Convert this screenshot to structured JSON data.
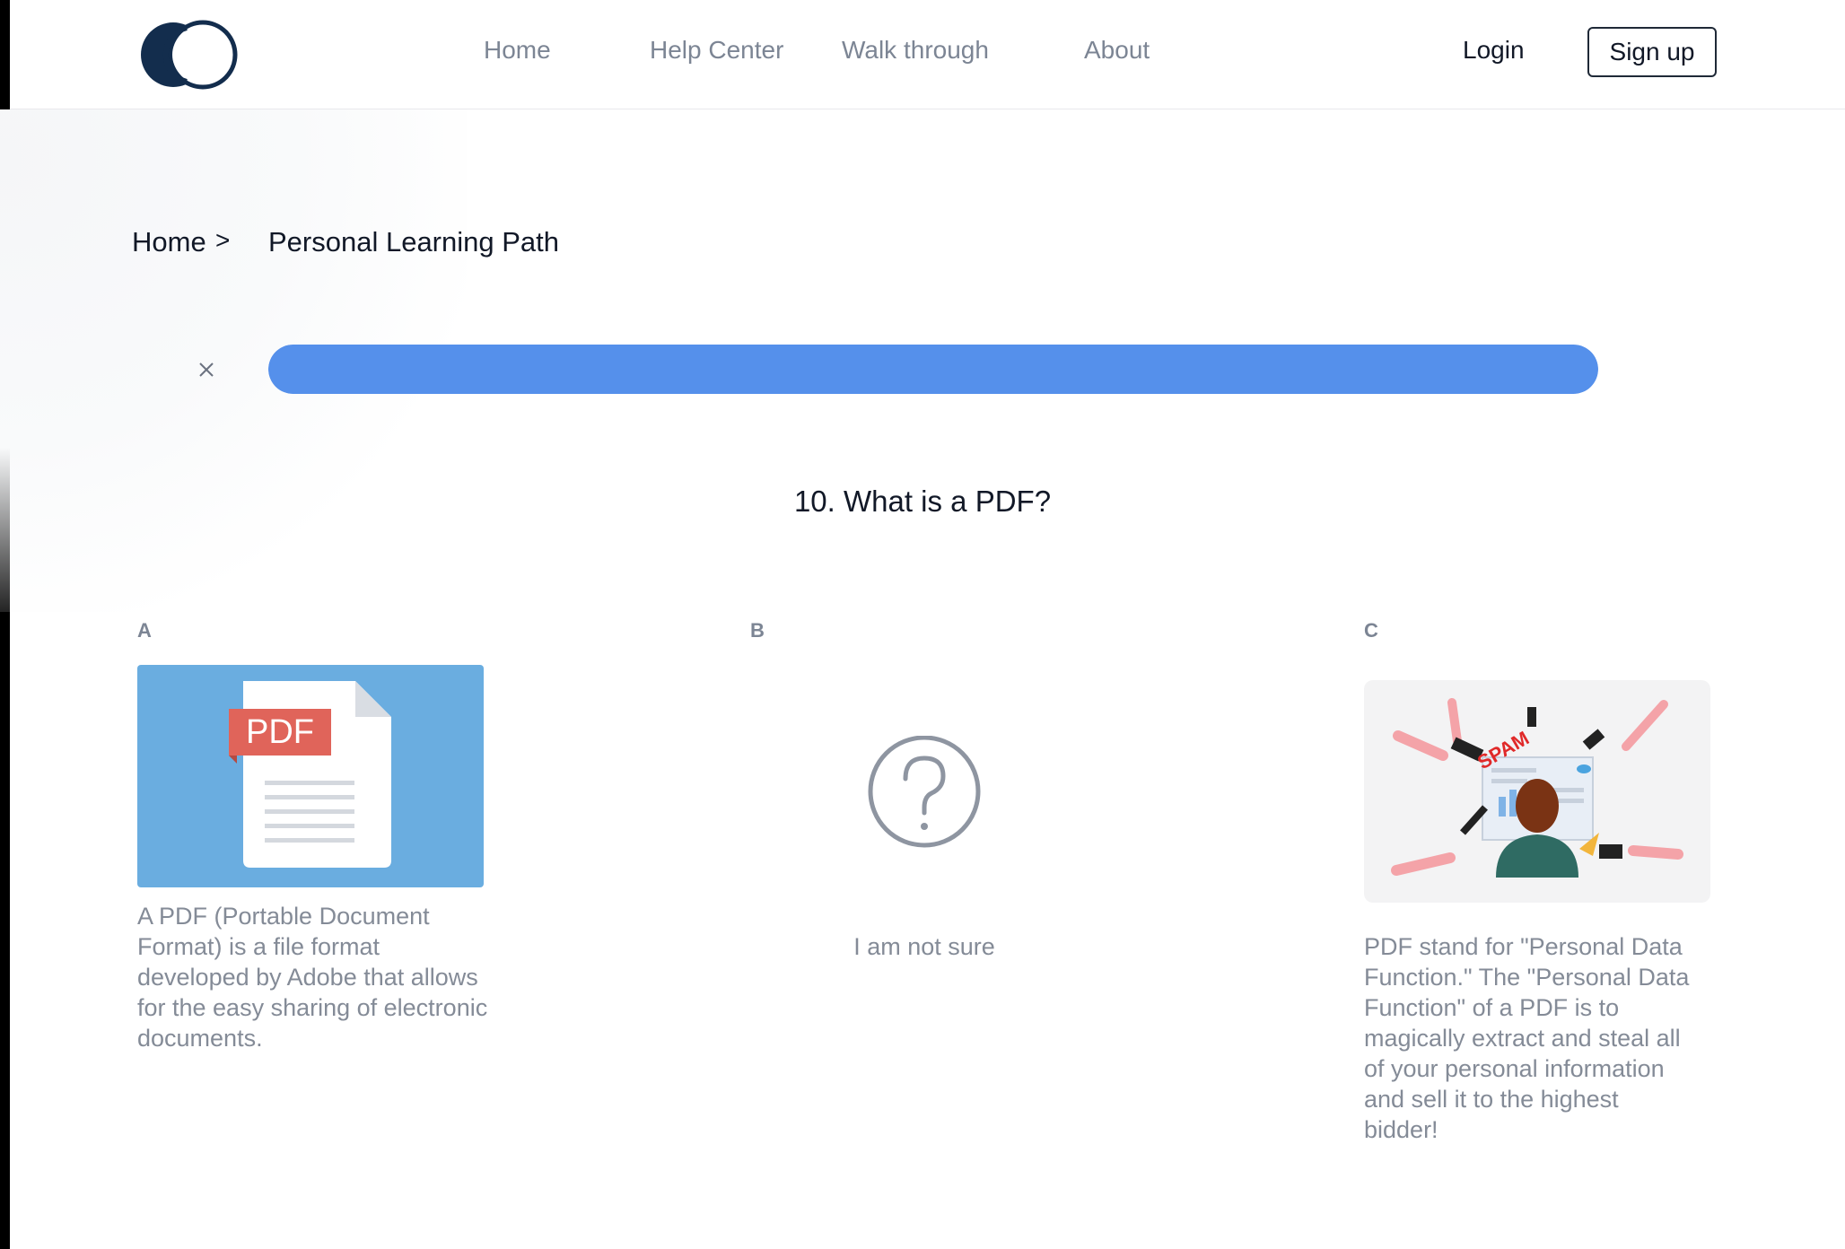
{
  "header": {
    "nav": [
      "Home",
      "Help Center",
      "Walk through",
      "About"
    ],
    "login_label": "Login",
    "signup_label": "Sign up"
  },
  "breadcrumb": {
    "home": "Home",
    "separator": ">",
    "current": "Personal Learning Path"
  },
  "progress": {
    "fraction": 1.0
  },
  "question": {
    "text": "10. What is a PDF?"
  },
  "options": [
    {
      "letter": "A",
      "image": "pdf-file-icon",
      "image_text": "PDF",
      "text": "A PDF (Portable Document Format) is a file format developed by Adobe that allows for the easy sharing of electronic documents."
    },
    {
      "letter": "B",
      "image": "question-mark-icon",
      "text": "I am not sure"
    },
    {
      "letter": "C",
      "image": "spam-illustration",
      "image_text": "SPAM",
      "text": "PDF stand for \"Personal Data Function.\" The \"Personal Data Function\" of a PDF is to magically extract and steal all of your personal information and sell it to the highest bidder!"
    }
  ],
  "colors": {
    "accent": "#5590eb",
    "pdf_card_bg": "#6aade0",
    "pdf_badge": "#e0645a",
    "logo": "#132d4d",
    "muted_text": "#7c8594"
  }
}
